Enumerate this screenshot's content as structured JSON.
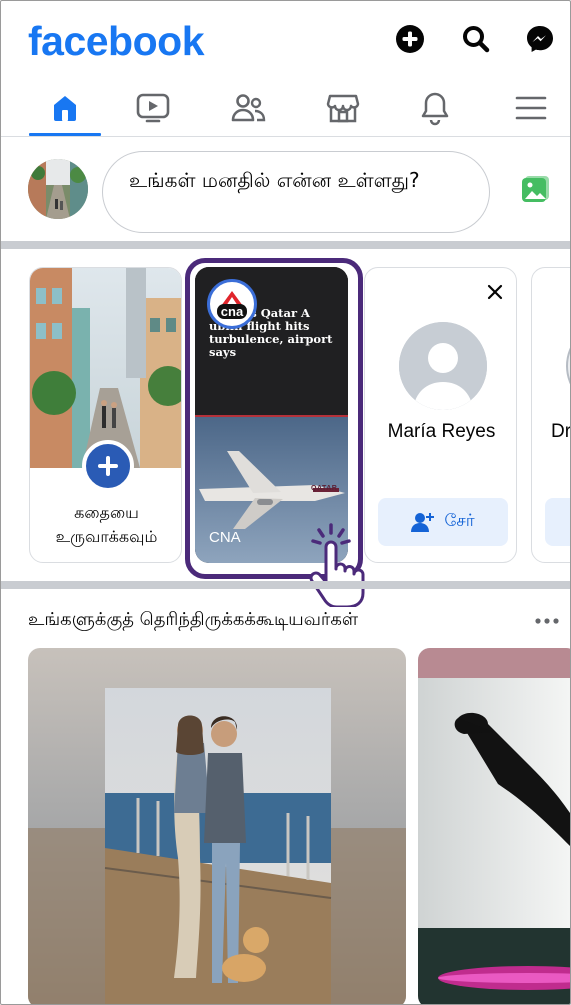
{
  "header": {
    "logo": "facebook",
    "brand_color": "#1877f2",
    "icons": [
      "add-icon",
      "search-icon",
      "messenger-icon"
    ]
  },
  "nav": {
    "tabs": [
      {
        "name": "home",
        "icon": "home-icon",
        "active": true
      },
      {
        "name": "video",
        "icon": "video-icon",
        "active": false
      },
      {
        "name": "friends",
        "icon": "friends-icon",
        "active": false
      },
      {
        "name": "marketplace",
        "icon": "marketplace-icon",
        "active": false
      },
      {
        "name": "notifications",
        "icon": "bell-icon",
        "active": false
      },
      {
        "name": "menu",
        "icon": "menu-icon",
        "active": false
      }
    ]
  },
  "composer": {
    "placeholder": "உங்கள் மனதில் என்ன உள்ளது?",
    "photo_icon": "photo-icon",
    "photo_color": "#45bd62"
  },
  "stories": {
    "create": {
      "label": "கதையை உருவாக்கவும்"
    },
    "cna": {
      "headline": "ured as Qatar A ublin flight hits turbulence, airport says",
      "logo_text": "cna",
      "name": "CNA",
      "plane_text": "QATAR"
    },
    "person": {
      "name": "María Reyes",
      "add_label": "சேர்"
    },
    "partial": {
      "name": "Dr'"
    }
  },
  "suggestions": {
    "title": "உங்களுக்குத் தெரிந்திருக்கக்கூடியவர்கள்"
  }
}
